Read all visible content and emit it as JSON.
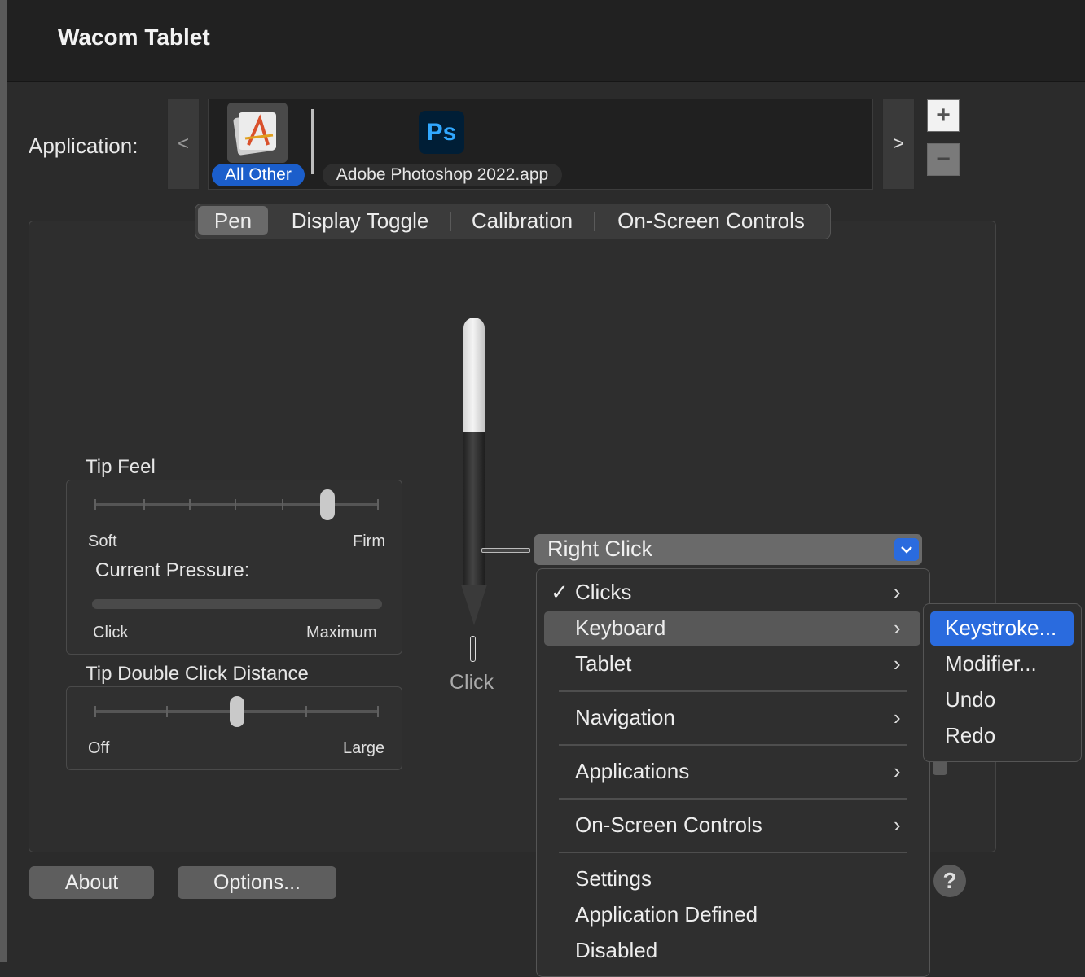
{
  "window": {
    "title": "Wacom Tablet"
  },
  "application": {
    "label": "Application:",
    "prev": "<",
    "next": ">",
    "add": "+",
    "remove": "−",
    "apps": [
      {
        "label": "All Other",
        "selected": true
      },
      {
        "label": "Adobe Photoshop 2022.app",
        "icon_text": "Ps",
        "selected": false
      }
    ]
  },
  "tabs": [
    {
      "label": "Pen",
      "selected": true
    },
    {
      "label": "Display Toggle",
      "selected": false
    },
    {
      "label": "Calibration",
      "selected": false
    },
    {
      "label": "On-Screen Controls",
      "selected": false
    }
  ],
  "tip_feel": {
    "title": "Tip Feel",
    "min_label": "Soft",
    "max_label": "Firm",
    "level_fraction": 0.82,
    "pressure_label": "Current Pressure:",
    "pressure_min": "Click",
    "pressure_max": "Maximum",
    "pressure_fraction": 0
  },
  "tip_double_click": {
    "title": "Tip Double Click Distance",
    "min_label": "Off",
    "max_label": "Large",
    "level_fraction": 0.5
  },
  "pen": {
    "tip_label": "Click"
  },
  "dropdown": {
    "value": "Right Click"
  },
  "menu": {
    "items": [
      {
        "label": "Clicks",
        "checked": true,
        "submenu": true
      },
      {
        "label": "Keyboard",
        "highlighted": true,
        "submenu": true
      },
      {
        "label": "Tablet",
        "submenu": true
      },
      {
        "label": "Navigation",
        "submenu": true
      },
      {
        "label": "Applications",
        "submenu": true
      },
      {
        "label": "On-Screen Controls",
        "submenu": true
      },
      {
        "label": "Settings"
      },
      {
        "label": "Application Defined"
      },
      {
        "label": "Disabled"
      }
    ],
    "check_mark": "✓",
    "chevron": "›"
  },
  "submenu": {
    "items": [
      {
        "label": "Keystroke...",
        "highlighted": true
      },
      {
        "label": "Modifier..."
      },
      {
        "label": "Undo"
      },
      {
        "label": "Redo"
      }
    ]
  },
  "footer": {
    "about": "About",
    "options": "Options...",
    "help": "?"
  },
  "colors": {
    "accent": "#2a6bde",
    "background": "#2b2b2b"
  }
}
